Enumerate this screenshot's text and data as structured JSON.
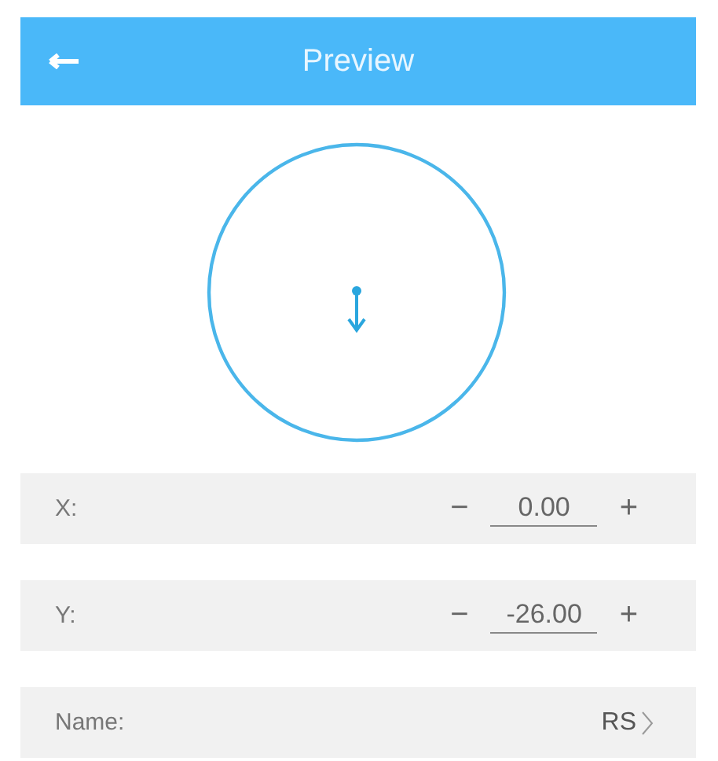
{
  "header": {
    "title": "Preview"
  },
  "rows": [
    {
      "kind": "stepper",
      "label": "X:",
      "minus": "−",
      "value": "0.00",
      "plus": "+"
    },
    {
      "kind": "stepper",
      "label": "Y:",
      "minus": "−",
      "value": "-26.00",
      "plus": "+"
    },
    {
      "kind": "link",
      "label": "Name:",
      "value": "RS"
    }
  ]
}
